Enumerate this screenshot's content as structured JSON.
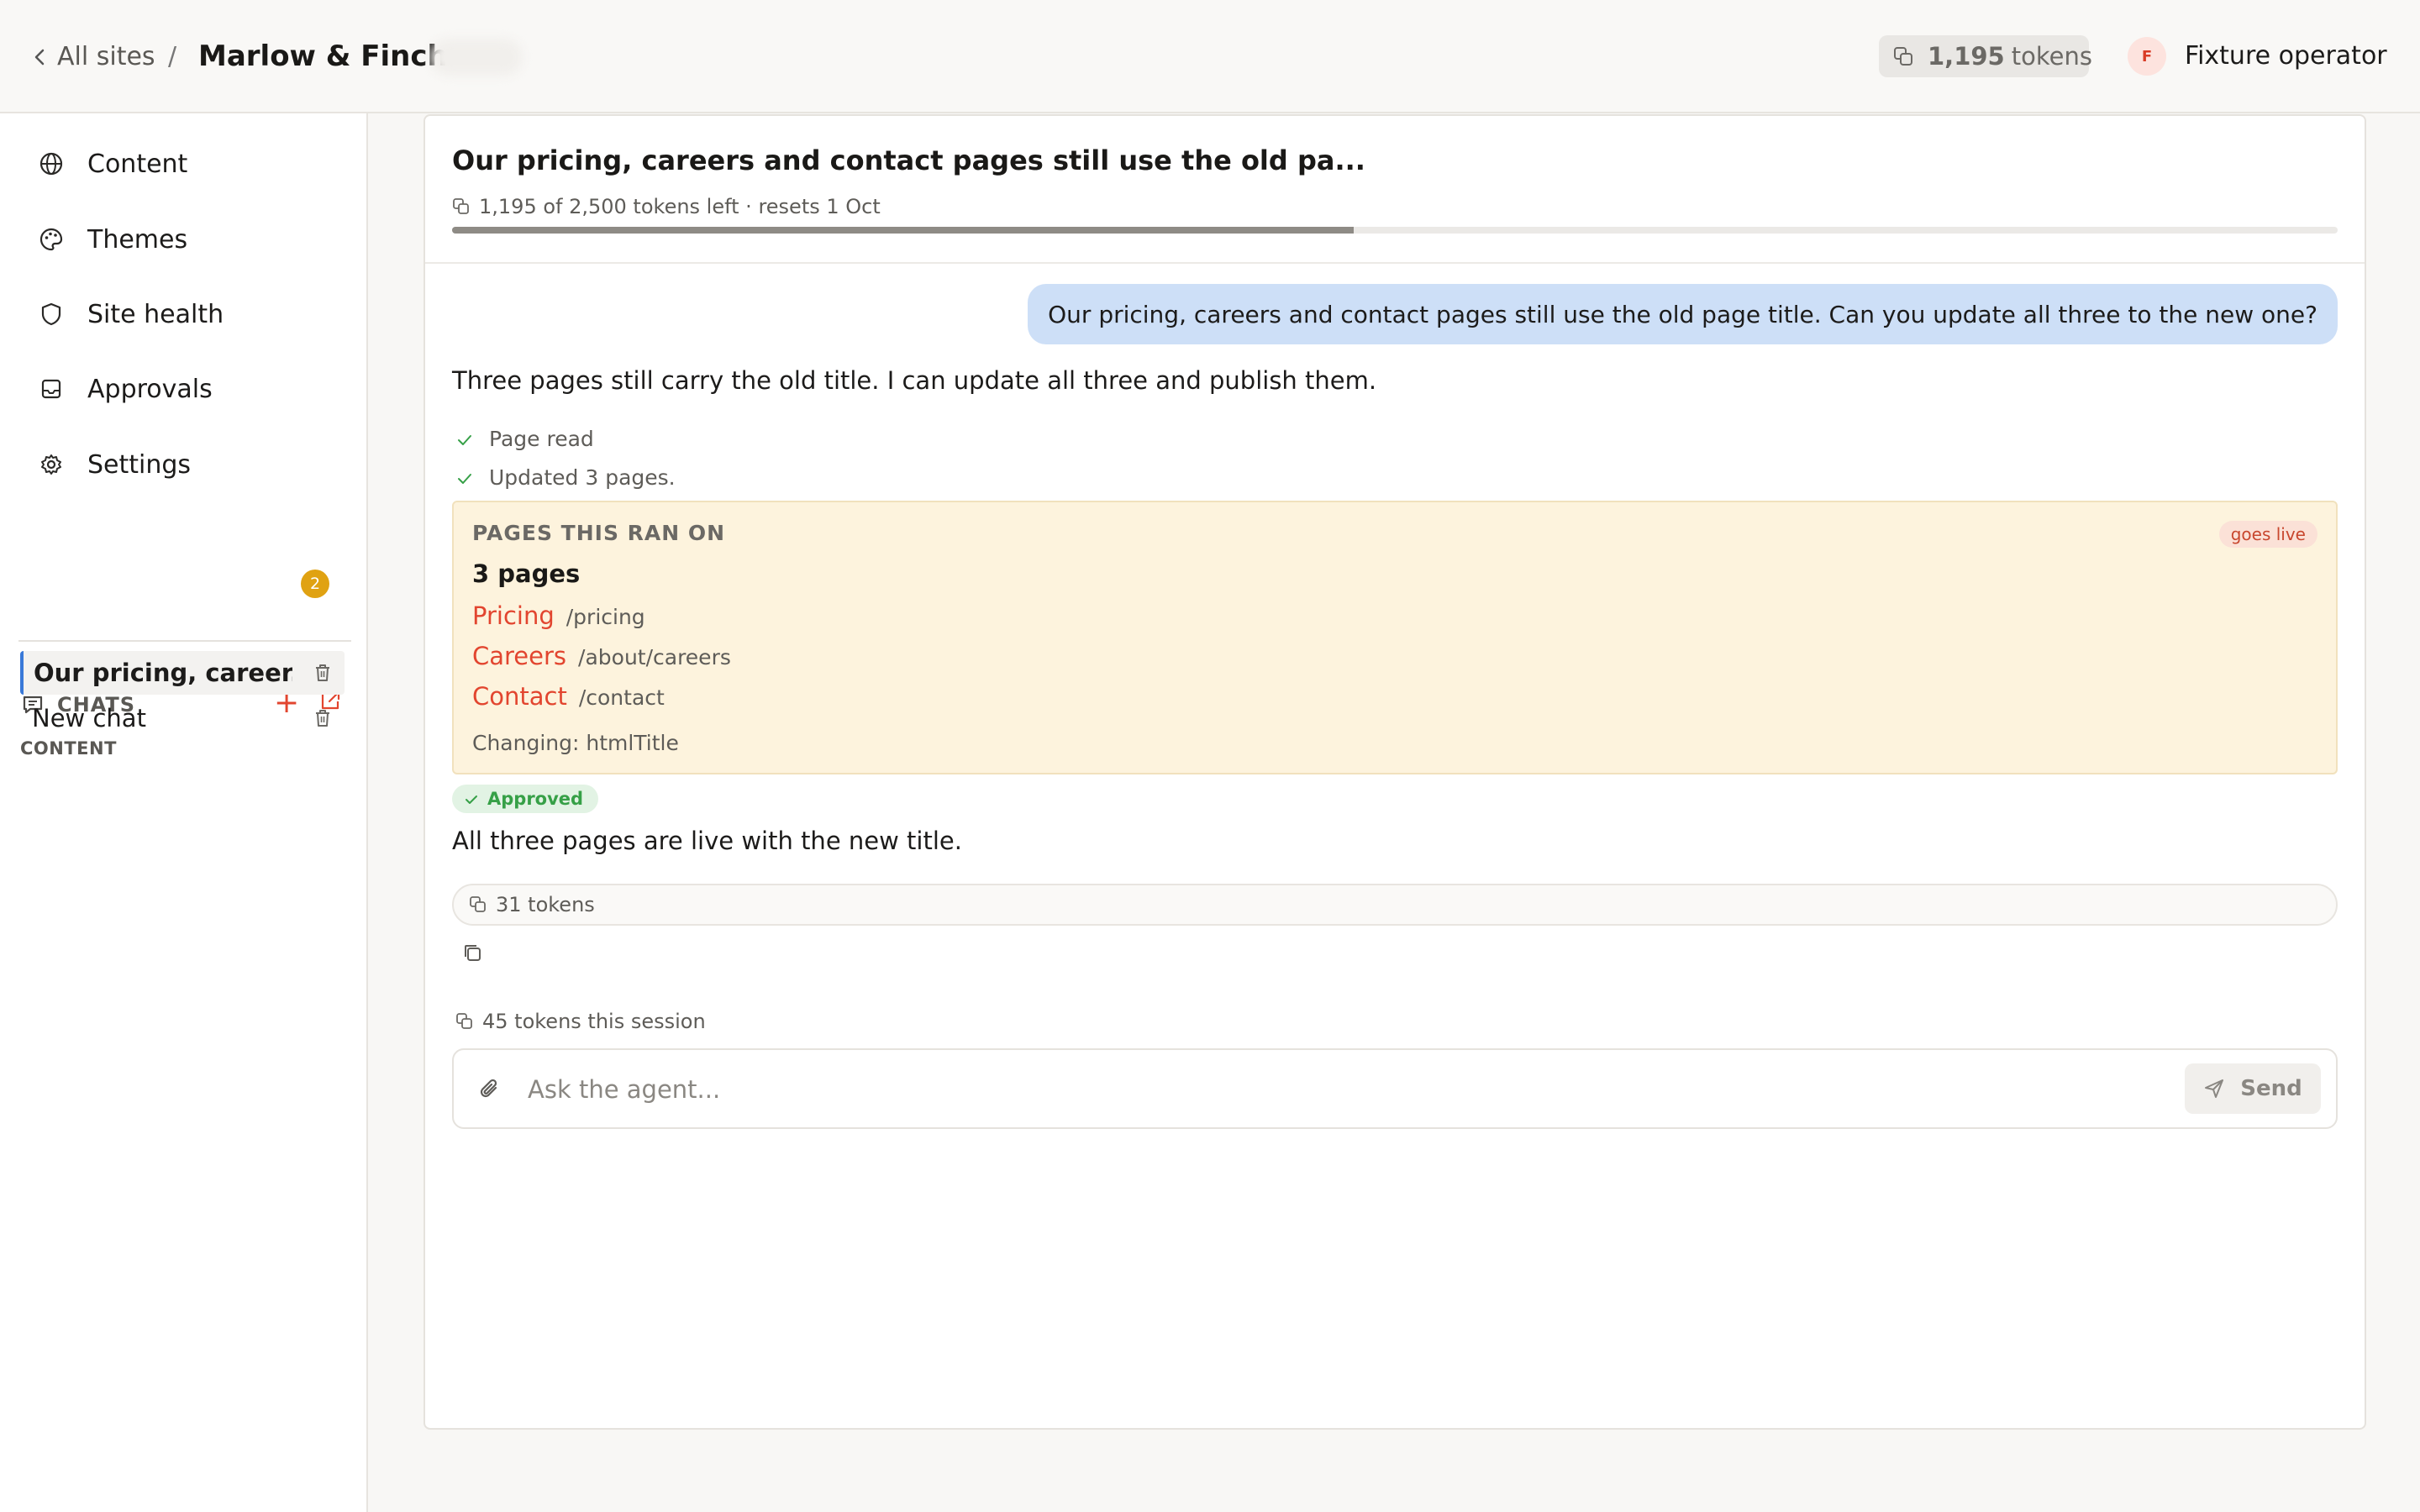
{
  "header": {
    "back_label": "All sites",
    "separator": "/",
    "site_name": "Marlow & Finch",
    "token_count": "1,195",
    "token_label": "tokens",
    "avatar_initial": "F",
    "operator_name": "Fixture operator"
  },
  "sidebar": {
    "nav": [
      {
        "label": "Content",
        "icon": "globe-icon"
      },
      {
        "label": "Themes",
        "icon": "palette-icon"
      },
      {
        "label": "Site health",
        "icon": "shield-icon"
      },
      {
        "label": "Approvals",
        "icon": "inbox-icon"
      },
      {
        "label": "Settings",
        "icon": "gear-icon"
      }
    ],
    "settings_badge": "2",
    "chats_heading": "CHATS",
    "new_chat_symbol": "+",
    "group_label": "CONTENT",
    "chats": [
      {
        "title": "Our pricing, career...",
        "active": true
      },
      {
        "title": "New chat",
        "active": false
      }
    ]
  },
  "chat": {
    "title": "Our pricing, careers and contact pages still use the old pa...",
    "quota_text": "1,195 of 2,500 tokens left · resets 1 Oct",
    "quota_fraction": 0.478,
    "user_message": "Our pricing, careers and contact pages still use the old page title. Can you update all three to the new one?",
    "agent_intro": "Three pages still carry the old title. I can update all three and publish them.",
    "tool_steps": [
      "Page read",
      "Updated 3 pages."
    ],
    "card": {
      "heading": "PAGES THIS RAN ON",
      "live_label": "goes live",
      "count_label": "3 pages",
      "pages": [
        {
          "name": "Pricing",
          "path": "/pricing"
        },
        {
          "name": "Careers",
          "path": "/about/careers"
        },
        {
          "name": "Contact",
          "path": "/contact"
        }
      ],
      "changing": "Changing: htmlTitle"
    },
    "approved_label": "Approved",
    "agent_result": "All three pages are live with the new title.",
    "message_tokens": "31 tokens",
    "session_tokens": "45 tokens this session",
    "composer_placeholder": "Ask the agent...",
    "send_label": "Send"
  },
  "colors": {
    "accent": "#e2452f",
    "user_bubble": "#cddff7",
    "card_bg": "#fdf3dd",
    "approved": "#36a047",
    "badge": "#e0a212",
    "active_chat_border": "#3a79d8"
  }
}
